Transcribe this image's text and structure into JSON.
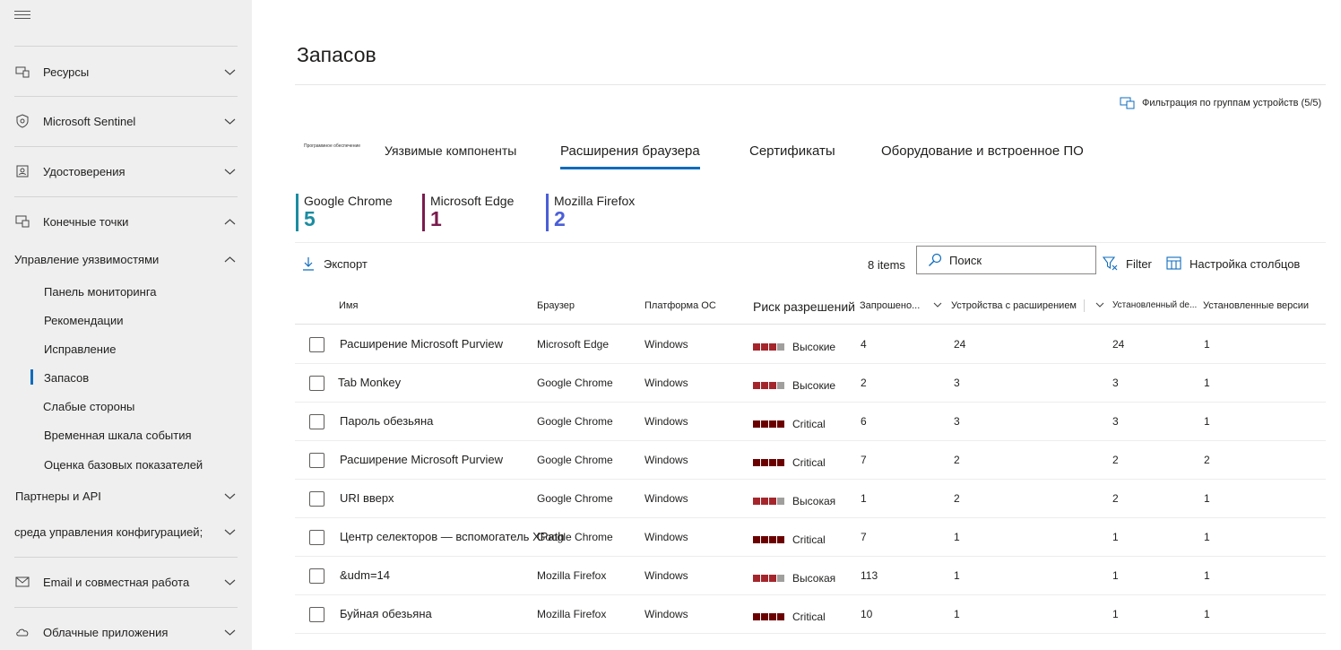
{
  "sidebar": {
    "items": [
      {
        "label": "Ресурсы",
        "icon": "devices-icon"
      },
      {
        "label": "Microsoft Sentinel",
        "icon": "shield-icon"
      },
      {
        "label": "Удостоверения",
        "icon": "identity-card-icon"
      },
      {
        "label": "Конечные точки",
        "icon": "endpoint-icon"
      }
    ],
    "vuln_group": "Управление уязвимостями",
    "sub_items": [
      "Панель мониторинга",
      "Рекомендации",
      "Исправление",
      "Запасов",
      "Слабые стороны",
      "Временная шкала события",
      "Оценка базовых показателей"
    ],
    "partners": "Партнеры и API",
    "config": "среда управления конфигурацией;",
    "email": "Email и совместная работа",
    "cloud": "Облачные приложения"
  },
  "page": {
    "title": "Запасов",
    "device_filter": "Фильтрация по группам устройств (5/5)"
  },
  "tabs": {
    "tiny": "Программное обеспечение",
    "items": [
      "Уязвимые компоненты",
      "Расширения браузера",
      "Сертификаты",
      "Оборудование и встроенное ПО"
    ],
    "selected": "Расширения браузера"
  },
  "kpis": [
    {
      "label": "Google Chrome",
      "value": "5",
      "color": "#1a8ca0"
    },
    {
      "label": "Microsoft Edge",
      "value": "1",
      "color": "#7a1c4e"
    },
    {
      "label": "Mozilla Firefox",
      "value": "2",
      "color": "#4a5ed8"
    }
  ],
  "toolbar": {
    "export": "Экспорт",
    "items_count": "8 items",
    "search_placeholder": "Поиск",
    "filter": "Filter",
    "columns": "Настройка столбцов"
  },
  "table": {
    "headers": {
      "name": "Имя",
      "browser": "Браузер",
      "os": "Платформа ОС",
      "risk": "Риск разрешений",
      "requested": "Запрошено...",
      "devices": "Устройства с расширением",
      "installed_de": "Установленный de...",
      "versions": "Установленные версии"
    },
    "rows": [
      {
        "name": "Расширение Microsoft Purview",
        "browser": "Microsoft Edge",
        "os": "Windows",
        "risk": "Высокие",
        "level": 3,
        "requested": "4",
        "devices": "24",
        "installed": "24",
        "versions": "1"
      },
      {
        "name": "Tab Monkey",
        "browser": "Google Chrome",
        "os": "Windows",
        "risk": "Высокие",
        "level": 3,
        "requested": "2",
        "devices": "3",
        "installed": "3",
        "versions": "1"
      },
      {
        "name": "Пароль обезьяна",
        "browser": "Google Chrome",
        "os": "Windows",
        "risk": "Critical",
        "level": 4,
        "requested": "6",
        "devices": "3",
        "installed": "3",
        "versions": "1"
      },
      {
        "name": "Расширение Microsoft Purview",
        "browser": "Google Chrome",
        "os": "Windows",
        "risk": "Critical",
        "level": 4,
        "requested": "7",
        "devices": "2",
        "installed": "2",
        "versions": "2"
      },
      {
        "name": "URI вверх",
        "browser": "Google Chrome",
        "os": "Windows",
        "risk": "Высокая",
        "level": 3,
        "requested": "1",
        "devices": "2",
        "installed": "2",
        "versions": "1"
      },
      {
        "name": "Центр селекторов — вспомогатель XPath",
        "browser": "Google Chrome",
        "os": "Windows",
        "risk": "Critical",
        "level": 4,
        "requested": "7",
        "devices": "1",
        "installed": "1",
        "versions": "1"
      },
      {
        "name": "&udm=14",
        "browser": "Mozilla Firefox",
        "os": "Windows",
        "risk": "Высокая",
        "level": 3,
        "requested": "113",
        "devices": "1",
        "installed": "1",
        "versions": "1"
      },
      {
        "name": "Буйная обезьяна",
        "browser": "Mozilla Firefox",
        "os": "Windows",
        "risk": "Critical",
        "level": 4,
        "requested": "10",
        "devices": "1",
        "installed": "1",
        "versions": "1"
      }
    ]
  },
  "colors": {
    "accent": "#0f6cbd",
    "risk_high": "#a4262c",
    "risk_critical": "#6b0000",
    "risk_empty": "#a19f9d"
  }
}
